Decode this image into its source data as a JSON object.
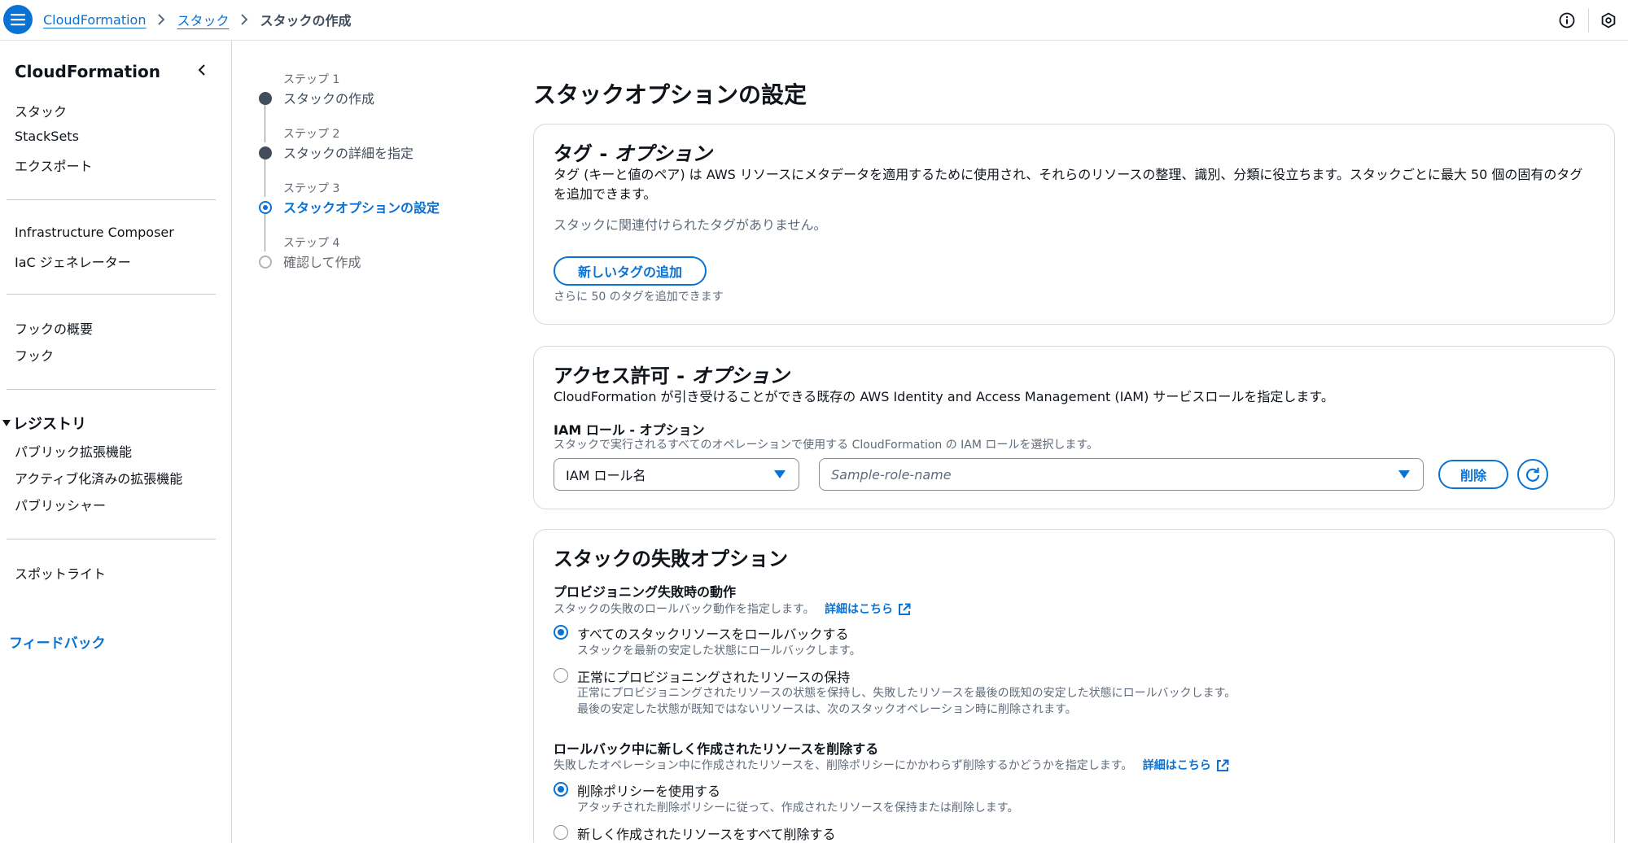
{
  "header": {
    "breadcrumbs": [
      "CloudFormation",
      "スタック",
      "スタックの作成"
    ]
  },
  "sidebar": {
    "title": "CloudFormation",
    "group1": [
      "スタック",
      "StackSets",
      "エクスポート"
    ],
    "group2": [
      "Infrastructure Composer",
      "IaC ジェネレーター"
    ],
    "group3": [
      "フックの概要",
      "フック"
    ],
    "registry": {
      "title": "レジストリ",
      "items": [
        "パブリック拡張機能",
        "アクティブ化済みの拡張機能",
        "パブリッシャー"
      ]
    },
    "group5": [
      "スポットライト"
    ],
    "feedback": "フィードバック"
  },
  "steps": [
    {
      "num": "ステップ 1",
      "label": "スタックの作成",
      "state": "done"
    },
    {
      "num": "ステップ 2",
      "label": "スタックの詳細を指定",
      "state": "done"
    },
    {
      "num": "ステップ 3",
      "label": "スタックオプションの設定",
      "state": "active"
    },
    {
      "num": "ステップ 4",
      "label": "確認して作成",
      "state": "future"
    }
  ],
  "main": {
    "title": "スタックオプションの設定",
    "tags": {
      "heading": "タグ - ",
      "heading_italic": "オプション",
      "description": "タグ (キーと値のペア) は AWS リソースにメタデータを適用するために使用され、それらのリソースの整理、識別、分類に役立ちます。スタックごとに最大 50 個の固有のタグを追加できます。",
      "empty": "スタックに関連付けられたタグがありません。",
      "add_button": "新しいタグの追加",
      "remaining": "さらに 50 のタグを追加できます"
    },
    "permissions": {
      "heading": "アクセス許可 - ",
      "heading_italic": "オプション",
      "description": "CloudFormation が引き受けることができる既存の AWS Identity and Access Management (IAM) サービスロールを指定します。",
      "iam_label": "IAM ロール - オプション",
      "iam_hint": "スタックで実行されるすべてのオペレーションで使用する CloudFormation の IAM ロールを選択します。",
      "type_select": "IAM ロール名",
      "role_placeholder": "Sample-role-name",
      "delete_button": "削除"
    },
    "failure": {
      "heading": "スタックの失敗オプション",
      "provision_label": "プロビジョニング失敗時の動作",
      "provision_hint": "スタックの失敗のロールバック動作を指定します。",
      "learn_more": "詳細はこちら",
      "opt1_label": "すべてのスタックリソースをロールバックする",
      "opt1_desc": "スタックを最新の安定した状態にロールバックします。",
      "opt2_label": "正常にプロビジョニングされたリソースの保持",
      "opt2_desc": "正常にプロビジョニングされたリソースの状態を保持し、失敗したリソースを最後の既知の安定した状態にロールバックします。最後の安定した状態が既知ではないリソースは、次のスタックオペレーション時に削除されます。",
      "delete_label": "ロールバック中に新しく作成されたリソースを削除する",
      "delete_hint": "失敗したオペレーション中に作成されたリソースを、削除ポリシーにかかわらず削除するかどうかを指定します。",
      "learn_more2": "詳細はこちら",
      "opt3_label": "削除ポリシーを使用する",
      "opt3_desc": "アタッチされた削除ポリシーに従って、作成されたリソースを保持または削除します。",
      "opt4_label": "新しく作成されたリソースをすべて削除する"
    }
  },
  "colors": {
    "accent": "#0972d3",
    "text": "#0f141a",
    "muted": "#5f6b7a",
    "border": "#d5dbdb"
  }
}
